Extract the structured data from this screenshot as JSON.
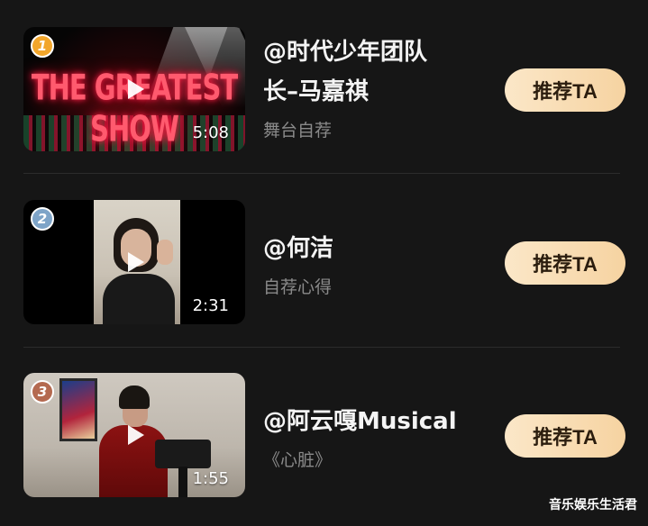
{
  "items": [
    {
      "rank": "1",
      "rank_color": "#f2a62b",
      "thumbnail_text": "THE GREATEST SHOW",
      "duration": "5:08",
      "title_line1": "@时代少年团队",
      "title_line2": "长–马嘉祺",
      "subtitle": "舞台自荐",
      "button_label": "推荐TA"
    },
    {
      "rank": "2",
      "rank_color": "#7ea4c8",
      "duration": "2:31",
      "title_line1": "@何洁",
      "subtitle": "自荐心得",
      "button_label": "推荐TA"
    },
    {
      "rank": "3",
      "rank_color": "#b46a50",
      "duration": "1:55",
      "title_line1": "@阿云嘎Musical",
      "subtitle": "《心脏》",
      "button_label": "推荐TA"
    }
  ],
  "watermark": "音乐娱乐生活君",
  "colors": {
    "background": "#161616",
    "button_gradient_start": "#fbe7c8",
    "button_gradient_end": "#f6d3a1",
    "subtitle": "#8a8a8a"
  },
  "icons": [
    "play-icon",
    "rank-badge"
  ]
}
